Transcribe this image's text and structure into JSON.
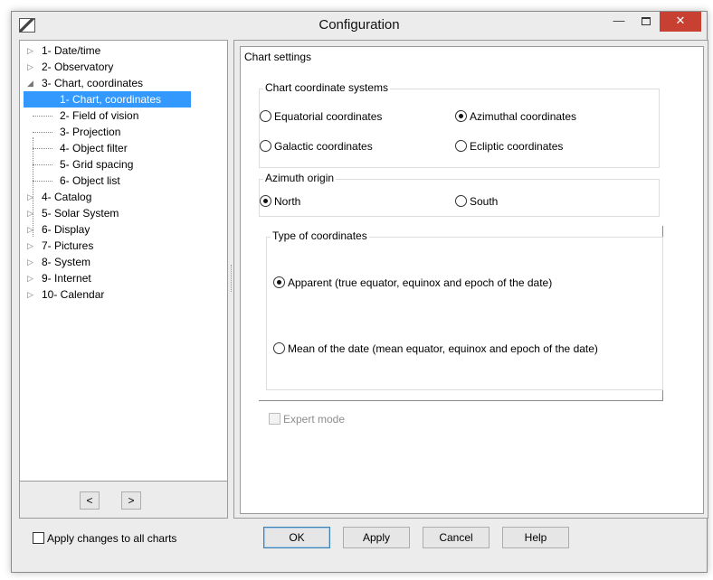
{
  "window": {
    "title": "Configuration"
  },
  "tree": {
    "items": [
      {
        "label": "1- Date/time",
        "expander": "▷",
        "level": 0
      },
      {
        "label": "2- Observatory",
        "expander": "▷",
        "level": 0
      },
      {
        "label": "3- Chart, coordinates",
        "expander": "◢",
        "level": 0
      },
      {
        "label": "1- Chart, coordinates",
        "expander": "",
        "level": 1,
        "selected": true
      },
      {
        "label": "2- Field of vision",
        "expander": "",
        "level": 1
      },
      {
        "label": "3- Projection",
        "expander": "",
        "level": 1
      },
      {
        "label": "4- Object filter",
        "expander": "",
        "level": 1
      },
      {
        "label": "5- Grid spacing",
        "expander": "",
        "level": 1
      },
      {
        "label": "6- Object list",
        "expander": "",
        "level": 1
      },
      {
        "label": "4- Catalog",
        "expander": "▷",
        "level": 0
      },
      {
        "label": "5- Solar System",
        "expander": "▷",
        "level": 0
      },
      {
        "label": "6- Display",
        "expander": "▷",
        "level": 0
      },
      {
        "label": "7- Pictures",
        "expander": "▷",
        "level": 0
      },
      {
        "label": "8- System",
        "expander": "▷",
        "level": 0
      },
      {
        "label": "9- Internet",
        "expander": "▷",
        "level": 0
      },
      {
        "label": "10- Calendar",
        "expander": "▷",
        "level": 0
      }
    ],
    "prev_label": "<",
    "next_label": ">"
  },
  "settings": {
    "title": "Chart settings",
    "coord_systems": {
      "legend": "Chart coordinate systems",
      "equatorial": "Equatorial coordinates",
      "azimuthal": "Azimuthal coordinates",
      "galactic": "Galactic coordinates",
      "ecliptic": "Ecliptic coordinates",
      "selected": "azimuthal"
    },
    "azimuth_origin": {
      "legend": "Azimuth origin",
      "north": "North",
      "south": "South",
      "selected": "north"
    },
    "coord_type": {
      "legend": "Type of coordinates",
      "apparent": "Apparent (true equator, equinox and epoch of the date)",
      "mean": "Mean of the date (mean equator, equinox and epoch of the date)",
      "selected": "apparent"
    },
    "expert_mode": "Expert mode"
  },
  "footer": {
    "apply_all": "Apply changes to all charts",
    "ok": "OK",
    "apply": "Apply",
    "cancel": "Cancel",
    "help": "Help"
  },
  "colors": {
    "selection": "#3399ff",
    "close_button": "#c84031",
    "window_bg": "#ececec"
  }
}
